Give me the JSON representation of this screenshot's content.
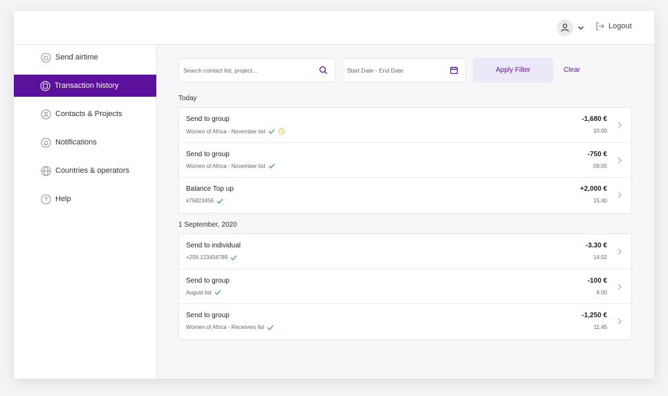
{
  "header": {
    "logout_label": "Logout"
  },
  "sidebar": {
    "items": [
      {
        "label": "Send airtime",
        "icon": "home-icon"
      },
      {
        "label": "Transaction history",
        "icon": "receipt-icon",
        "active": true
      },
      {
        "label": "Contacts & Projects",
        "icon": "user-icon"
      },
      {
        "label": "Notifications",
        "icon": "bell-icon"
      },
      {
        "label": "Countries & operators",
        "icon": "globe-icon"
      },
      {
        "label": "Help",
        "icon": "help-icon"
      }
    ]
  },
  "filters": {
    "search_placeholder": "Search contact list, project...",
    "date_placeholder": "Start Date - End Date",
    "apply_label": "Apply Filter",
    "clear_label": "Clear"
  },
  "groups": [
    {
      "label": "Today",
      "transactions": [
        {
          "title": "Send to group",
          "sub": "Women of Africa - November list",
          "amount": "-1,680 €",
          "time": "10:00",
          "status": "pending"
        },
        {
          "title": "Send to group",
          "sub": "Women of Africa - November list",
          "amount": "-750 €",
          "time": "09:05",
          "status": "done"
        },
        {
          "title": "Balance Top up",
          "sub": "#76823456",
          "amount": "+2,000 €",
          "time": "15:40",
          "status": "done"
        }
      ]
    },
    {
      "label": "1 September, 2020",
      "transactions": [
        {
          "title": "Send to individual",
          "sub": "+256 123456789",
          "amount": "-3.30 €",
          "time": "14:02",
          "status": "done"
        },
        {
          "title": "Send to group",
          "sub": "August list",
          "amount": "-100 €",
          "time": "9:00",
          "status": "done"
        },
        {
          "title": "Send to group",
          "sub": "Women of Africa - Receivers list",
          "amount": "-1,250 €",
          "time": "11:45",
          "status": "done"
        }
      ]
    }
  ],
  "colors": {
    "accent": "#5b119b",
    "check": "#3aa655",
    "pending": "#e8b93a"
  }
}
